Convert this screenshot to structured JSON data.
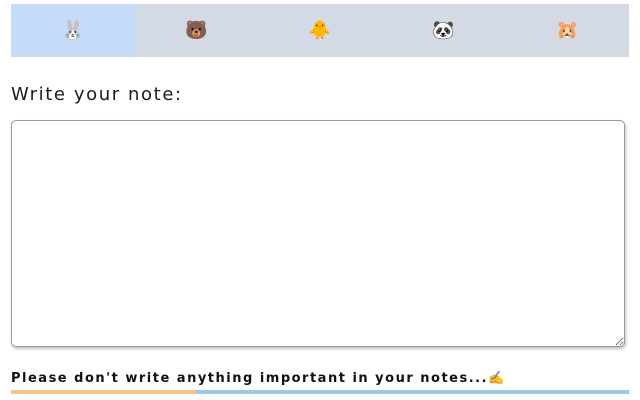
{
  "tabs": [
    {
      "emoji": "🐰",
      "name": "rabbit",
      "active": true
    },
    {
      "emoji": "🐻",
      "name": "bear",
      "active": false
    },
    {
      "emoji": "🐥",
      "name": "chick",
      "active": false
    },
    {
      "emoji": "🐼",
      "name": "panda",
      "active": false
    },
    {
      "emoji": "🐹",
      "name": "hamster",
      "active": false
    }
  ],
  "note": {
    "label": "Write your note:",
    "value": ""
  },
  "warning_text": "Please don't write anything important in your notes...✍️",
  "progress": {
    "fraction": 0.3,
    "fill_color": "#f5c582",
    "track_color": "#9ec9e6"
  },
  "colors": {
    "tab_bg": "#d4dae3",
    "tab_active_bg": "#c5dcf8"
  }
}
